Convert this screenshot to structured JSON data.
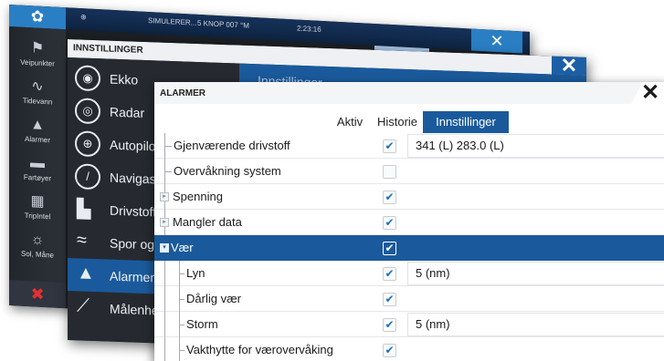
{
  "back_window": {
    "gear_icon": "gear-icon",
    "status_left": "SIMULERER...",
    "status_speed": "5 KNOP 007 °M",
    "status_time": "2:23:16",
    "close_icon": "close-icon",
    "sidebar": [
      {
        "label": "Veipunkter",
        "icon": "⚑",
        "name": "flag-icon"
      },
      {
        "label": "Tidevann",
        "icon": "∿",
        "name": "tide-icon"
      },
      {
        "label": "Alarmer",
        "icon": "🔔",
        "name": "bell-icon"
      },
      {
        "label": "Fartøyer",
        "icon": "⛴",
        "name": "vessel-icon"
      },
      {
        "label": "TripIntel",
        "icon": "▦",
        "name": "tripintel-icon"
      },
      {
        "label": "Sol, Måne",
        "icon": "☼",
        "name": "sun-moon-icon"
      }
    ],
    "bottom_icon": "✖"
  },
  "middle_window": {
    "title": "INNSTILLINGER",
    "header": "Innstillinger...",
    "items": [
      {
        "label": "Ekko",
        "icon": "◉",
        "name": "sonar-icon"
      },
      {
        "label": "Radar",
        "icon": "◎",
        "name": "radar-icon"
      },
      {
        "label": "Autopilot",
        "icon": "⊕",
        "name": "autopilot-icon"
      },
      {
        "label": "Navigasjo",
        "icon": "➚",
        "name": "navigation-icon"
      },
      {
        "label": "Drivstoff",
        "icon": "⛽",
        "name": "fuel-icon"
      },
      {
        "label": "Spor og tu",
        "icon": "〰",
        "name": "trails-icon"
      },
      {
        "label": "Alarmer",
        "icon": "🔔",
        "name": "bell-icon"
      },
      {
        "label": "Målenhet",
        "icon": "📏",
        "name": "ruler-icon"
      }
    ]
  },
  "front_window": {
    "title": "ALARMER",
    "tabs": [
      "Aktiv",
      "Historie",
      "Innstillinger"
    ],
    "active_tab": "Innstillinger",
    "rows": [
      {
        "name": "Gjenværende drivstoff",
        "checked": true,
        "value": "341 (L)  283.0 (L)"
      },
      {
        "name": "Overvåkning system",
        "checked": false,
        "value": ""
      },
      {
        "name": "Spenning",
        "checked": true,
        "value": ""
      },
      {
        "name": "Mangler data",
        "checked": true,
        "value": ""
      },
      {
        "name": "Vær",
        "checked": true,
        "value": "",
        "selected": true
      },
      {
        "name": "Lyn",
        "checked": true,
        "value": "5 (nm)"
      },
      {
        "name": "Dårlig vær",
        "checked": true,
        "value": ""
      },
      {
        "name": "Storm",
        "checked": true,
        "value": "5 (nm)"
      },
      {
        "name": "Vakthytte for værovervåking",
        "checked": true,
        "value": ""
      }
    ]
  }
}
